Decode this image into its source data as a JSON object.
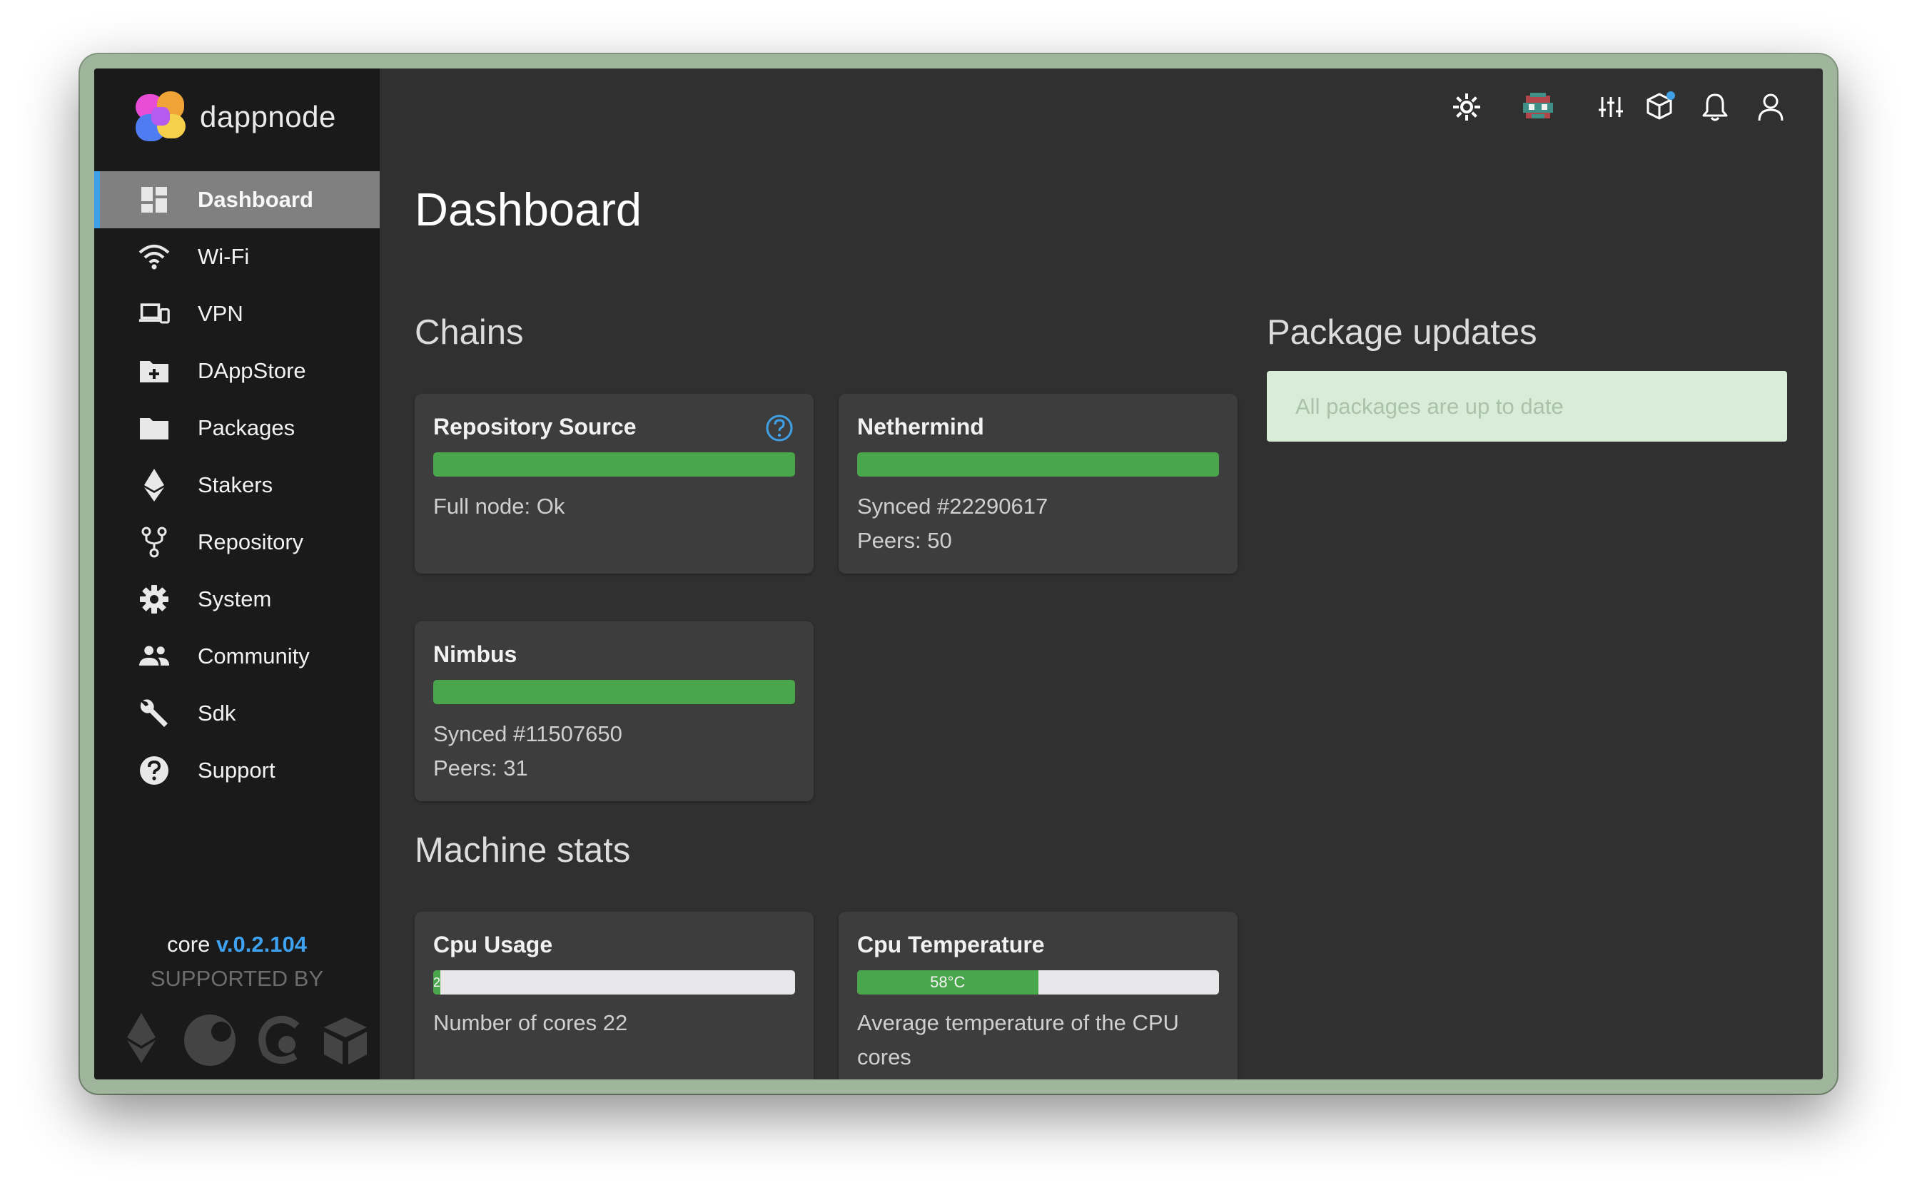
{
  "app": {
    "brand": "dappnode"
  },
  "sidebar": {
    "items": [
      {
        "label": "Dashboard",
        "icon": "dashboard-icon",
        "active": true
      },
      {
        "label": "Wi-Fi",
        "icon": "wifi-icon"
      },
      {
        "label": "VPN",
        "icon": "devices-icon"
      },
      {
        "label": "DAppStore",
        "icon": "folder-plus-icon"
      },
      {
        "label": "Packages",
        "icon": "folder-icon"
      },
      {
        "label": "Stakers",
        "icon": "ethereum-icon"
      },
      {
        "label": "Repository",
        "icon": "fork-icon"
      },
      {
        "label": "System",
        "icon": "gear-icon"
      },
      {
        "label": "Community",
        "icon": "people-icon"
      },
      {
        "label": "Sdk",
        "icon": "wrench-icon"
      },
      {
        "label": "Support",
        "icon": "help-circle-icon"
      }
    ],
    "core_label": "core",
    "core_version": "v.0.2.104",
    "supported_by": "SUPPORTED BY"
  },
  "topbar": {
    "icons": [
      "gear-sun-icon",
      "avatar-icon",
      "sliders-icon",
      "package-icon",
      "bell-icon",
      "user-icon"
    ]
  },
  "page": {
    "title": "Dashboard"
  },
  "chains": {
    "title": "Chains",
    "cards": [
      {
        "title": "Repository Source",
        "progress": 1.0,
        "lines": [
          "Full node: Ok"
        ]
      },
      {
        "title": "Nethermind",
        "progress": 1.0,
        "lines": [
          "Synced #22290617",
          "Peers: 50"
        ]
      },
      {
        "title": "Nimbus",
        "progress": 1.0,
        "lines": [
          "Synced #11507650",
          "Peers: 31"
        ]
      }
    ]
  },
  "package_updates": {
    "title": "Package updates",
    "message": "All packages are up to date"
  },
  "machine_stats": {
    "title": "Machine stats",
    "cpu_usage": {
      "title": "Cpu Usage",
      "value_label": "2",
      "percent": 2,
      "line": "Number of cores 22"
    },
    "cpu_temperature": {
      "title": "Cpu Temperature",
      "value_label": "58°C",
      "percent": 50,
      "line1": "Average temperature of the CPU",
      "line2": "cores"
    }
  },
  "colors": {
    "accent": "#3fa0e6",
    "ok_green": "#4aa64a",
    "sidebar": "#1a1a1a",
    "background": "#303030"
  }
}
